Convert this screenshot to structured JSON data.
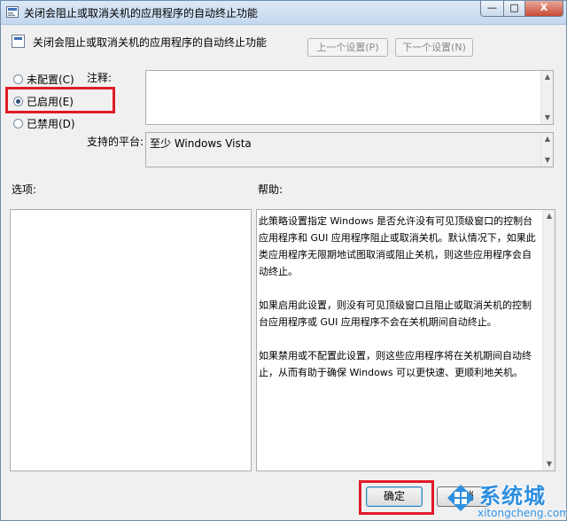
{
  "window": {
    "title": "关闭会阻止或取消关机的应用程序的自动终止功能",
    "caption_min": "—",
    "caption_max": "□",
    "caption_close": "X",
    "icon": "policy-icon"
  },
  "header": {
    "title": "关闭会阻止或取消关机的应用程序的自动终止功能",
    "prev_label": "上一个设置(P)",
    "next_label": "下一个设置(N)"
  },
  "state": {
    "options": [
      {
        "label": "未配置(C)",
        "selected": false
      },
      {
        "label": "已启用(E)",
        "selected": true
      },
      {
        "label": "已禁用(D)",
        "selected": false
      }
    ]
  },
  "comment": {
    "label": "注释:",
    "value": ""
  },
  "platform": {
    "label": "支持的平台:",
    "value": "至少 Windows Vista"
  },
  "options_section": {
    "label": "选项:"
  },
  "help": {
    "label": "帮助:",
    "paragraphs": [
      "此策略设置指定 Windows 是否允许没有可见顶级窗口的控制台应用程序和 GUI 应用程序阻止或取消关机。默认情况下，如果此类应用程序无限期地试图取消或阻止关机，则这些应用程序会自动终止。",
      "如果启用此设置，则没有可见顶级窗口且阻止或取消关机的控制台应用程序或 GUI 应用程序不会在关机期间自动终止。",
      "如果禁用或不配置此设置，则这些应用程序将在关机期间自动终止，从而有助于确保 Windows 可以更快速、更顺利地关机。"
    ]
  },
  "buttons": {
    "ok": "确定",
    "cancel": "取消"
  },
  "watermark": {
    "brand": "系统城",
    "url": "xitongcheng.com"
  },
  "colors": {
    "highlight": "#e01b2a",
    "watermark": "#2d8fe0"
  }
}
